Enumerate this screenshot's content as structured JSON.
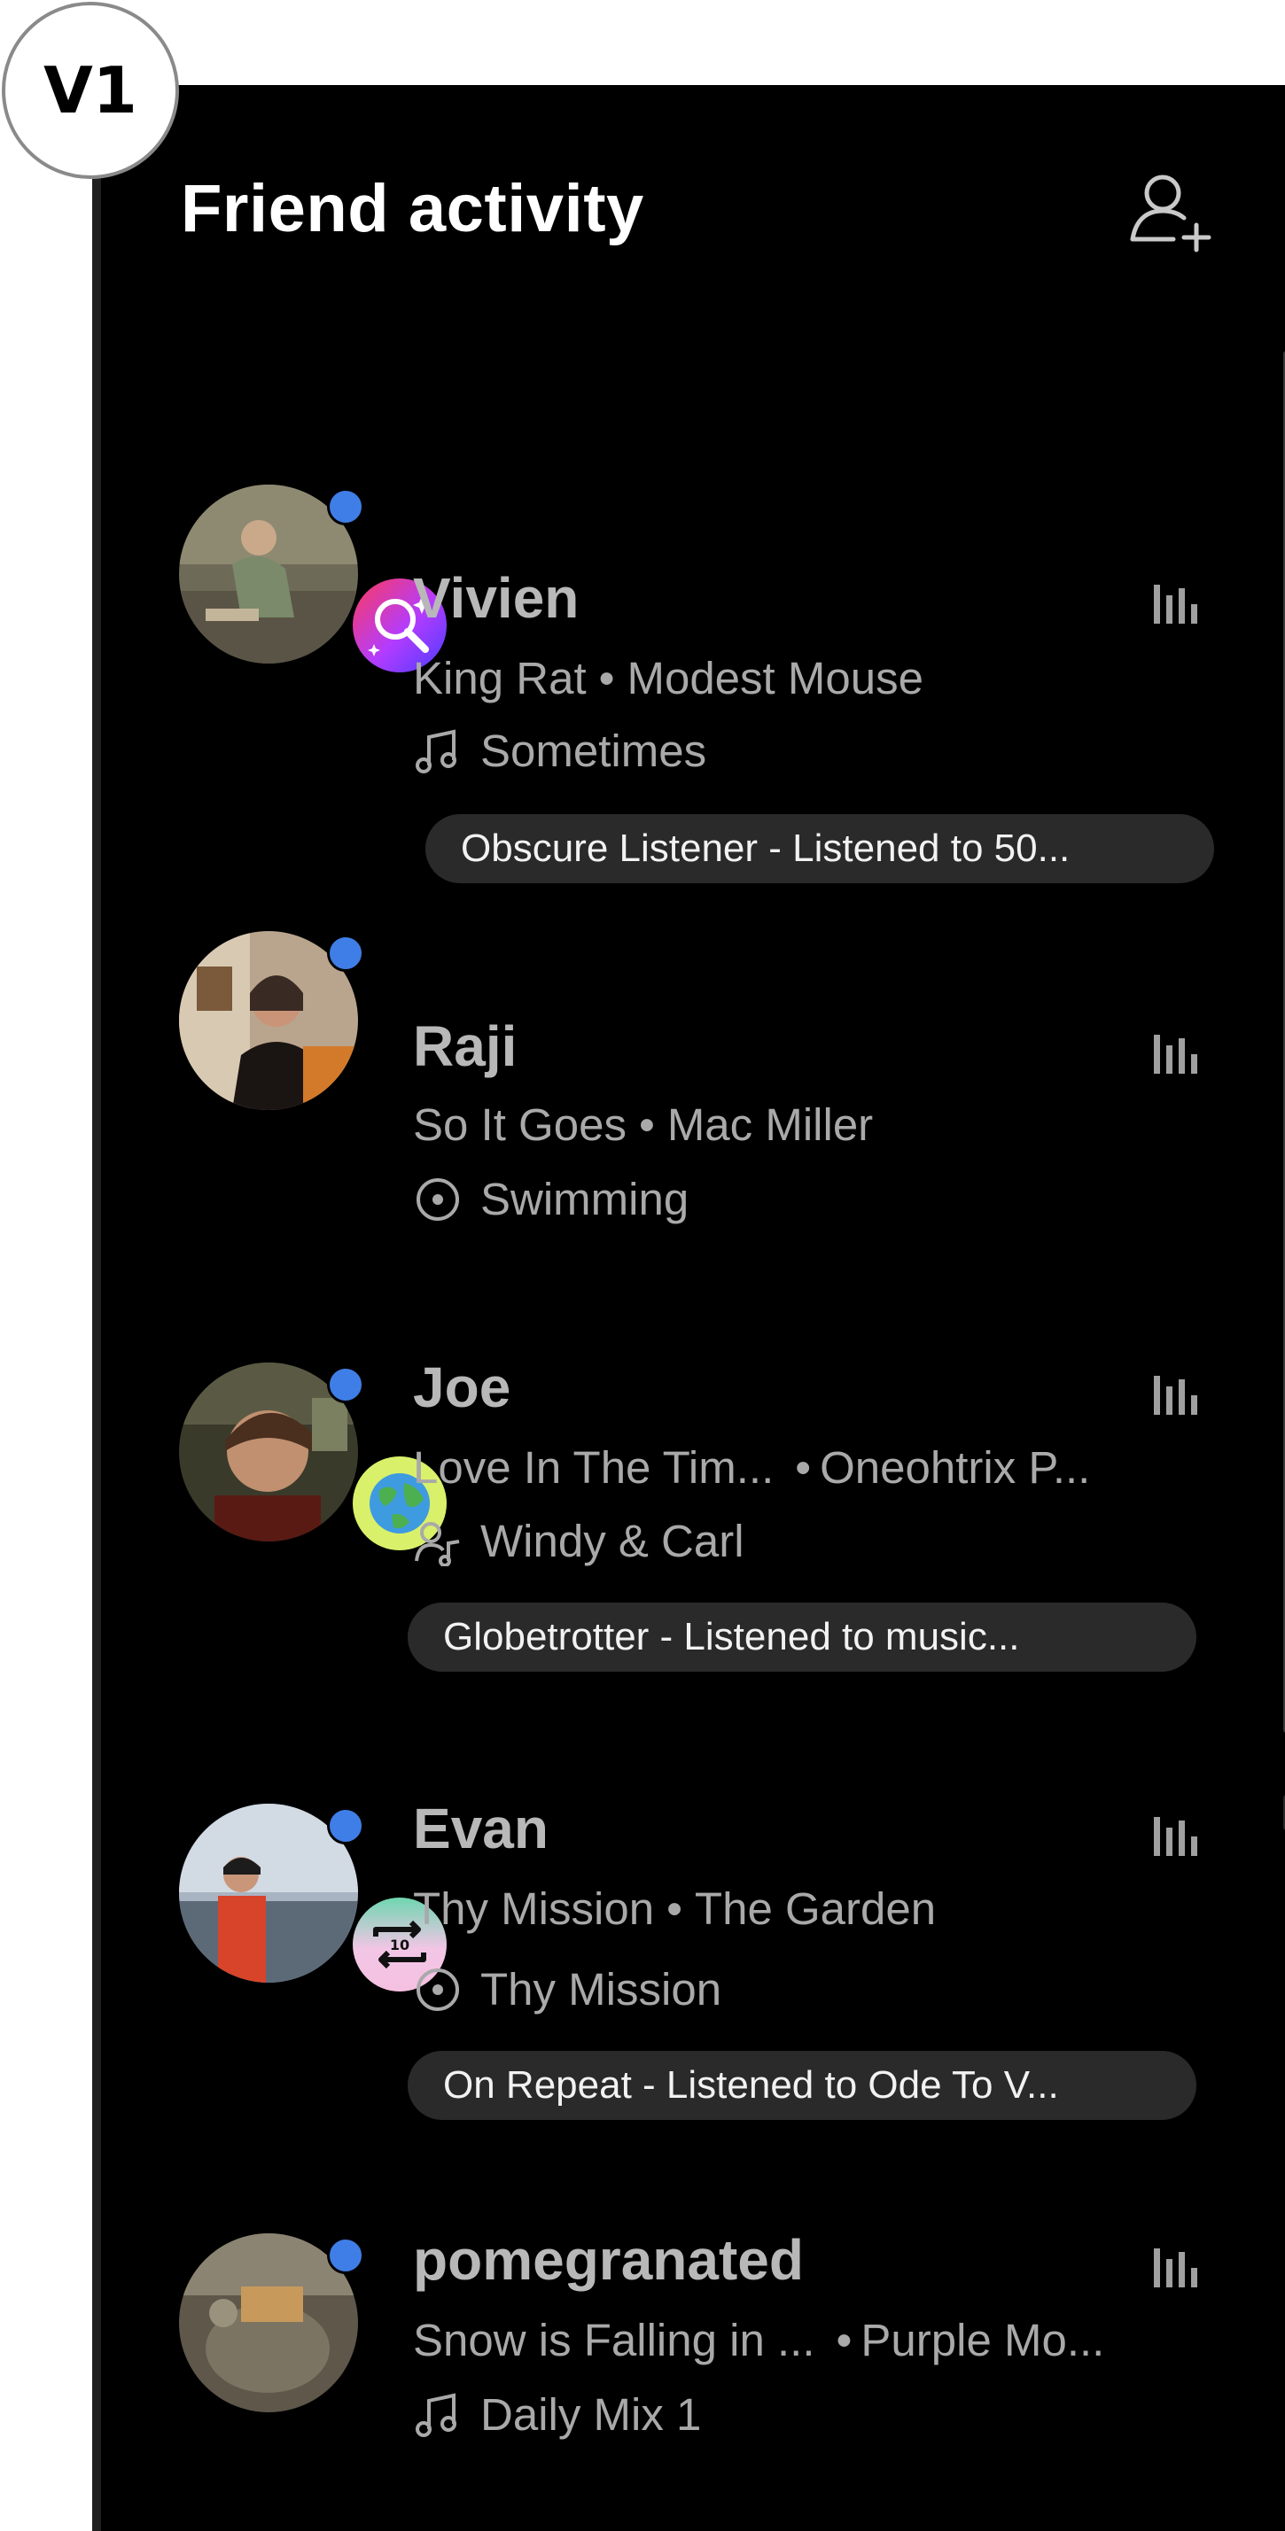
{
  "badge": {
    "label": "V1"
  },
  "panel": {
    "title": "Friend activity"
  },
  "icons": {
    "add_friend": "add-friend-icon",
    "playing": "equalizer-icon",
    "song": "music-note-icon",
    "album": "album-disc-icon",
    "artist": "artist-icon"
  },
  "colors": {
    "background": "#000000",
    "online": "#3f7ee6",
    "pill": "#2a2a2a"
  },
  "friends": [
    {
      "name": "Vivien",
      "song": "King Rat",
      "artist": "Modest Mouse",
      "context": "Sometimes",
      "context_icon": "music-note-icon",
      "badge_icon": "magnifier-sparkle-icon",
      "pill": "Obscure Listener - Listened to 50..."
    },
    {
      "name": "Raji",
      "song": "So It Goes",
      "artist": "Mac Miller",
      "context": "Swimming",
      "context_icon": "album-disc-icon"
    },
    {
      "name": "Joe",
      "song": "Love In The Tim...",
      "artist": "Oneohtrix P...",
      "context": "Windy & Carl",
      "context_icon": "artist-icon",
      "badge_icon": "globe-icon",
      "pill": "Globetrotter - Listened to music..."
    },
    {
      "name": "Evan",
      "song": "Thy Mission",
      "artist": "The Garden",
      "context": "Thy Mission",
      "context_icon": "album-disc-icon",
      "badge_icon": "repeat-icon",
      "badge_text": "10",
      "pill": "On Repeat - Listened to Ode To V..."
    },
    {
      "name": "pomegranated",
      "song": "Snow is Falling in ...",
      "artist": "Purple Mo...",
      "context": "Daily Mix 1",
      "context_icon": "music-note-icon"
    }
  ],
  "separator": "•"
}
